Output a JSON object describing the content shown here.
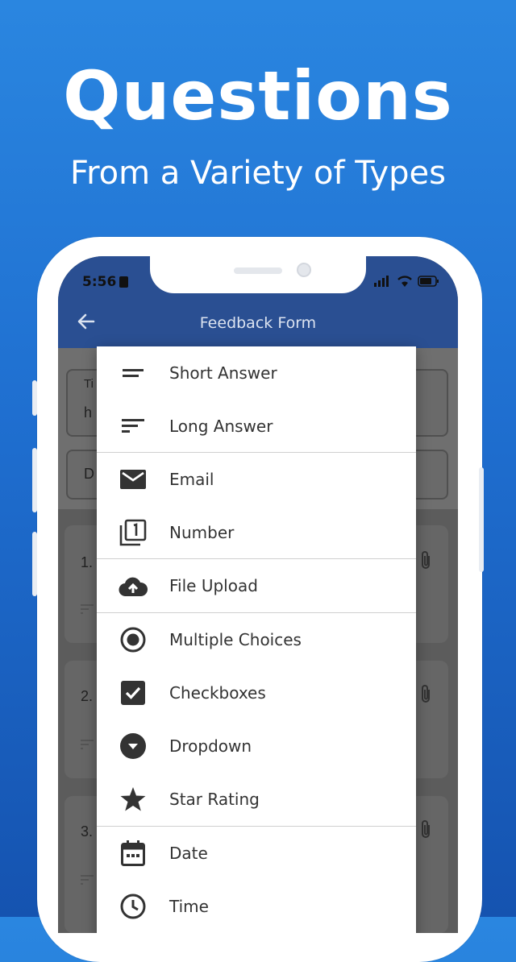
{
  "promo": {
    "headline": "Questions",
    "subheadline": "From a Variety of Types"
  },
  "status_bar": {
    "time": "5:56"
  },
  "app_bar": {
    "title": "Feedback Form"
  },
  "background_form": {
    "title_field_prefix": "Ti",
    "title_value_prefix": "h",
    "description_prefix": "D",
    "question_numbers": [
      "1.",
      "2.",
      "3."
    ]
  },
  "question_type_menu": {
    "items": [
      {
        "label": "Short Answer",
        "icon": "short-text-icon"
      },
      {
        "label": "Long Answer",
        "icon": "long-text-icon"
      },
      {
        "label": "Email",
        "icon": "email-icon"
      },
      {
        "label": "Number",
        "icon": "number-icon"
      },
      {
        "label": "File Upload",
        "icon": "cloud-upload-icon"
      },
      {
        "label": "Multiple Choices",
        "icon": "radio-icon"
      },
      {
        "label": "Checkboxes",
        "icon": "checkbox-icon"
      },
      {
        "label": "Dropdown",
        "icon": "dropdown-icon"
      },
      {
        "label": "Star Rating",
        "icon": "star-icon"
      },
      {
        "label": "Date",
        "icon": "calendar-icon"
      },
      {
        "label": "Time",
        "icon": "clock-icon"
      }
    ]
  },
  "colors": {
    "app_bar": "#2a4f92",
    "background_top": "#2a86e0",
    "background_bottom": "#1553b0",
    "icon": "#333333"
  }
}
